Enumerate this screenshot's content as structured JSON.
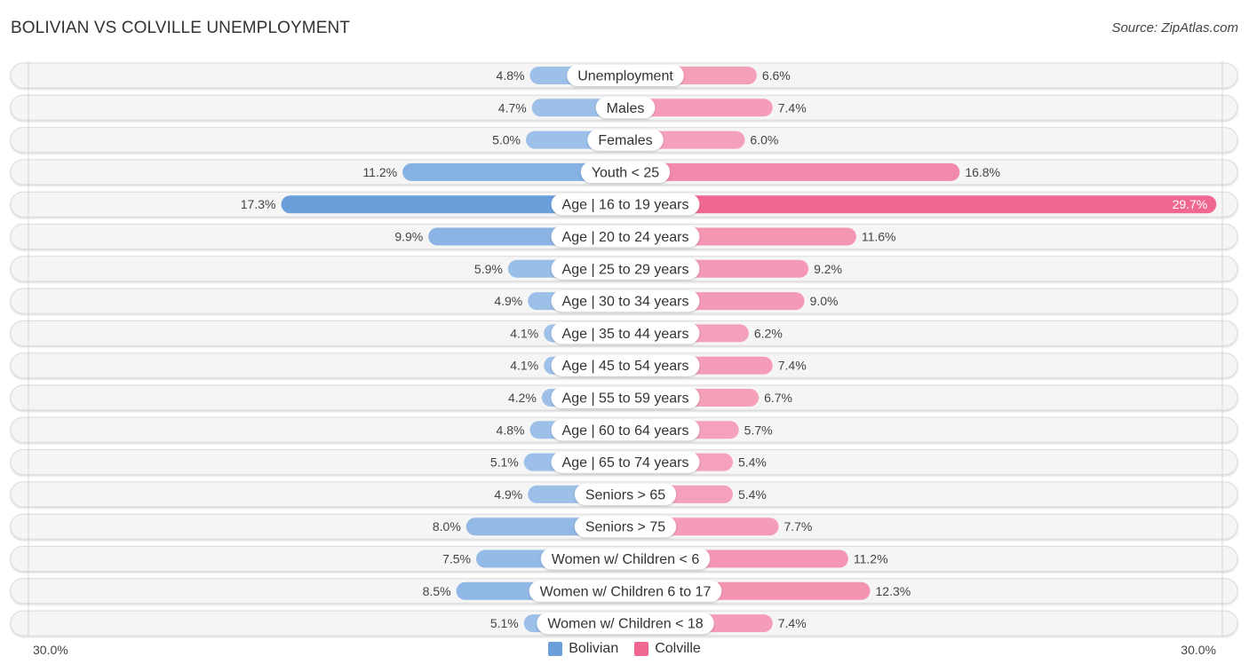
{
  "title": "BOLIVIAN VS COLVILLE UNEMPLOYMENT",
  "source": "Source: ZipAtlas.com",
  "axis": {
    "left_label": "30.0%",
    "right_label": "30.0%"
  },
  "legend": [
    {
      "name": "Bolivian",
      "color": "#6a9fdc"
    },
    {
      "name": "Colville",
      "color": "#f06892"
    }
  ],
  "chart_data": {
    "type": "bar",
    "orientation": "horizontal-diverging",
    "title": "BOLIVIAN VS COLVILLE UNEMPLOYMENT",
    "xlabel": "",
    "ylabel": "",
    "xlim": [
      0,
      30
    ],
    "value_format": "percent",
    "legend_position": "bottom-center",
    "grid": false,
    "categories": [
      "Unemployment",
      "Males",
      "Females",
      "Youth < 25",
      "Age | 16 to 19 years",
      "Age | 20 to 24 years",
      "Age | 25 to 29 years",
      "Age | 30 to 34 years",
      "Age | 35 to 44 years",
      "Age | 45 to 54 years",
      "Age | 55 to 59 years",
      "Age | 60 to 64 years",
      "Age | 65 to 74 years",
      "Seniors > 65",
      "Seniors > 75",
      "Women w/ Children < 6",
      "Women w/ Children 6 to 17",
      "Women w/ Children < 18"
    ],
    "series": [
      {
        "name": "Bolivian",
        "side": "left",
        "values": [
          4.8,
          4.7,
          5.0,
          11.2,
          17.3,
          9.9,
          5.9,
          4.9,
          4.1,
          4.1,
          4.2,
          4.8,
          5.1,
          4.9,
          8.0,
          7.5,
          8.5,
          5.1
        ]
      },
      {
        "name": "Colville",
        "side": "right",
        "values": [
          6.6,
          7.4,
          6.0,
          16.8,
          29.7,
          11.6,
          9.2,
          9.0,
          6.2,
          7.4,
          6.7,
          5.7,
          5.4,
          5.4,
          7.7,
          11.2,
          12.3,
          7.4
        ]
      }
    ]
  }
}
